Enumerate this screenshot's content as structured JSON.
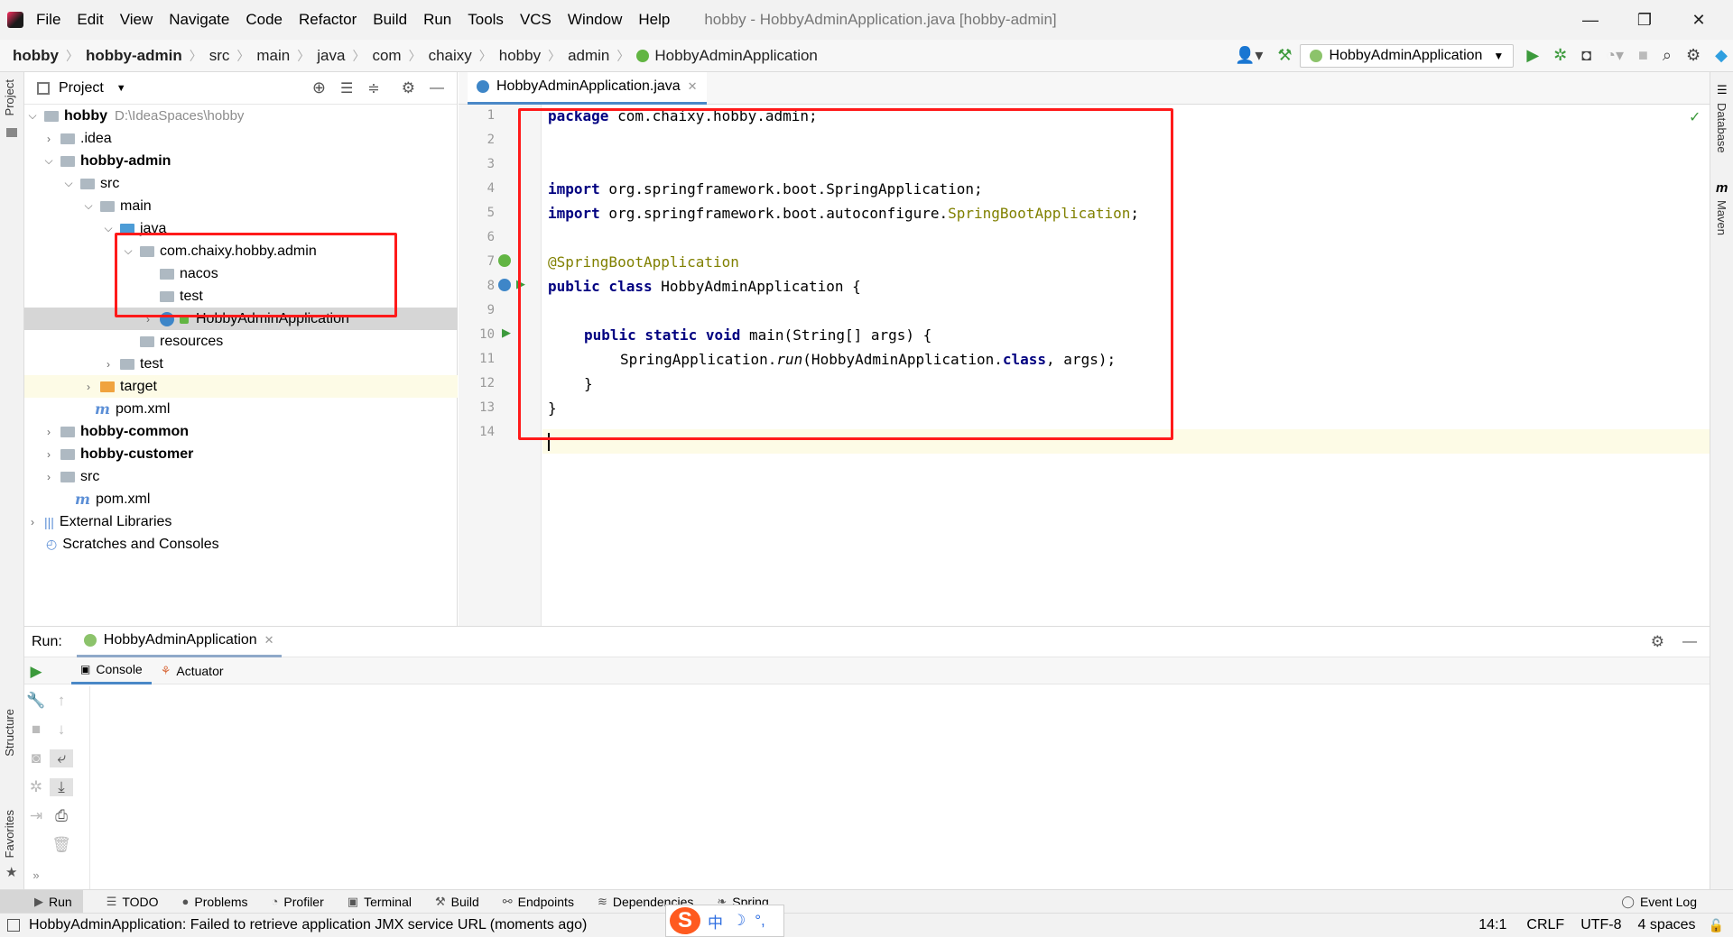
{
  "menubar": {
    "items": [
      "File",
      "Edit",
      "View",
      "Navigate",
      "Code",
      "Refactor",
      "Build",
      "Run",
      "Tools",
      "VCS",
      "Window",
      "Help"
    ],
    "window_title": "hobby - HobbyAdminApplication.java [hobby-admin]",
    "minimize": "—",
    "restore": "❐",
    "close": "✕"
  },
  "navbar": {
    "crumbs": [
      "hobby",
      "hobby-admin",
      "src",
      "main",
      "java",
      "com",
      "chaixy",
      "hobby",
      "admin",
      "HobbyAdminApplication"
    ],
    "run_config": "HobbyAdminApplication"
  },
  "left_stripe": {
    "project": "Project",
    "structure": "Structure",
    "favorites": "Favorites"
  },
  "right_stripe": {
    "database": "Database",
    "maven": "Maven"
  },
  "project_panel": {
    "title": "Project",
    "tree": [
      {
        "label": "hobby",
        "path": "D:\\IdeaSpaces\\hobby"
      },
      {
        "label": ".idea"
      },
      {
        "label": "hobby-admin"
      },
      {
        "label": "src"
      },
      {
        "label": "main"
      },
      {
        "label": "java"
      },
      {
        "label": "com.chaixy.hobby.admin"
      },
      {
        "label": "nacos"
      },
      {
        "label": "test"
      },
      {
        "label": "HobbyAdminApplication"
      },
      {
        "label": "resources"
      },
      {
        "label": "test"
      },
      {
        "label": "target"
      },
      {
        "label": "pom.xml"
      },
      {
        "label": "hobby-common"
      },
      {
        "label": "hobby-customer"
      },
      {
        "label": "src"
      },
      {
        "label": "pom.xml"
      },
      {
        "label": "External Libraries"
      },
      {
        "label": "Scratches and Consoles"
      }
    ]
  },
  "editor": {
    "tab": "HobbyAdminApplication.java",
    "line_numbers": [
      "1",
      "2",
      "3",
      "4",
      "5",
      "6",
      "7",
      "8",
      "9",
      "10",
      "11",
      "12",
      "13",
      "14"
    ],
    "code": {
      "l1_kw": "package",
      "l1_rest": " com.chaixy.hobby.admin;",
      "l4_kw": "import",
      "l4_rest": " org.springframework.boot.SpringApplication;",
      "l5_kw": "import",
      "l5_rest": " org.springframework.boot.autoconfigure.",
      "l5_ann": "SpringBootApplication",
      "l5_end": ";",
      "l7_ann": "@SpringBootApplication",
      "l8_kw": "public class",
      "l8_rest": " HobbyAdminApplication {",
      "l10_kw": "public static void",
      "l10_rest": " main(String[] args) {",
      "l11_a": "SpringApplication.",
      "l11_run": "run",
      "l11_b": "(HobbyAdminApplication.",
      "l11_kw": "class",
      "l11_c": ", args);",
      "l12": "}",
      "l13": "}"
    }
  },
  "run_panel": {
    "label": "Run:",
    "tab": "HobbyAdminApplication",
    "console": "Console",
    "actuator": "Actuator"
  },
  "bottom_tabs": [
    "Run",
    "TODO",
    "Problems",
    "Profiler",
    "Terminal",
    "Build",
    "Endpoints",
    "Dependencies",
    "Spring"
  ],
  "event_log": "Event Log",
  "statusbar": {
    "message": "HobbyAdminApplication: Failed to retrieve application JMX service URL (moments ago)",
    "position": "14:1",
    "line_sep": "CRLF",
    "encoding": "UTF-8",
    "indent": "4 spaces"
  },
  "ime": {
    "logo": "S",
    "lang": "中",
    "moon": "☽",
    "punct": "°,"
  },
  "colors": {
    "accent": "#4a88c7",
    "highlight_box": "#ff1a1a",
    "run_green": "#3c9a3c"
  }
}
